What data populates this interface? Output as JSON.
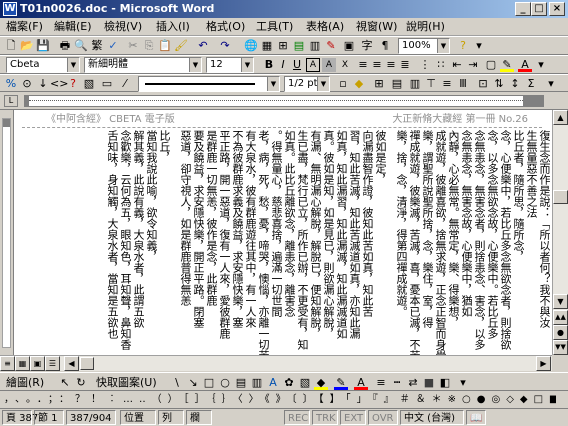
{
  "window": {
    "title": "T01n0026.doc - Microsoft Word",
    "app_icon": "word-icon"
  },
  "menu": [
    "檔案(F)",
    "編輯(E)",
    "檢視(V)",
    "插入(I)",
    "格式(O)",
    "工具(T)",
    "表格(A)",
    "視窗(W)",
    "說明(H)"
  ],
  "toolbar": {
    "zoom": "100%"
  },
  "format": {
    "style": "Cbeta",
    "font": "新細明體",
    "size": "12"
  },
  "draw_line": {
    "page": "1/2 pt"
  },
  "doc": {
    "header_left": "《中阿含經》 CBETA 電子版",
    "header_right": "大正新脩大藏經 第一冊 No.26",
    "columns": [
      "復生念而作是說：「所以者何？我不與汝",
      "生無量惡不善之法",
      "比丘者，隨所思，隨所念，",
      "念，心便樂中，若比丘多念無欲念者，則捨欲",
      "念，以多念無欲念故，心便樂中。若比丘多",
      "念無恚念，無害念者，則捨恚念、害念，以多",
      "念無恚念，無害念故，心便樂中，猶如",
      "內靜，心必無常。無常定，樂、得樂想，",
      "成就遊，彼離喜欲，捨無求遊，正念正智而身覺",
      "樂，謂聖所說聖所捨，念，樂住，室，得",
      "禪成就遊，彼樂滅，苦滅，喜，憂本已滅，不苦",
      "樂，捨，念，清淨，得第四禪成就遊。",
      "彼如是定，",
      "向漏盡智作證，彼知此苦如真，知此苦",
      "習，知此苦滅，知此苦滅道如真，亦知此漏",
      "如真，知此漏習，知此漏滅，知此漏滅道如",
      "真。彼如是知，如是見已，則欲漏心解脫，",
      "有漏、無明漏心解脫，解脫已，便知解脫，",
      "生已盡，梵行已立，所作已辦，不更受有，知",
      "如真。此比丘離欲念，離恚念，離害念",
      "。得無量心，慈悲喜捨，遍滿一切世間",
      "老，病，死，愁，憂，啼哭，懊惱，亦離一切苦，",
      "有大泉水，彼有群鹿遊往其中，有一人來",
      "不為彼群鹿求義及饒益，求安隱快樂，塞",
      "平正路，開一惡道，復有一人來，愛彼群鹿",
      "是群鹿一切無恙，彼作是念，此群鹿",
      "要及饒益，求安隱快樂，開正平路。閉塞",
      "惡道，卻守視人，如是群鹿普得無恙",
      "比丘，",
      "當知我說此喻，欲令知義，",
      "解其義，此說有義，大泉水者，此謂五欲",
      "念歡樂，云何為五，眼知色，耳知聲，鼻知香",
      "舌知味，身知觸，大泉水者，當知是五欲也"
    ]
  },
  "status": {
    "page": "頁 387",
    "section": "節 1",
    "position": "387/904",
    "at": "位置",
    "line": "列",
    "col": "欄",
    "rec": "REC",
    "trk": "TRK",
    "ext": "EXT",
    "ovr": "OVR",
    "lang": "中文 (台灣)"
  },
  "drawbar": {
    "draw": "繪圖(R)",
    "autoshapes": "快取圖案(U)"
  }
}
